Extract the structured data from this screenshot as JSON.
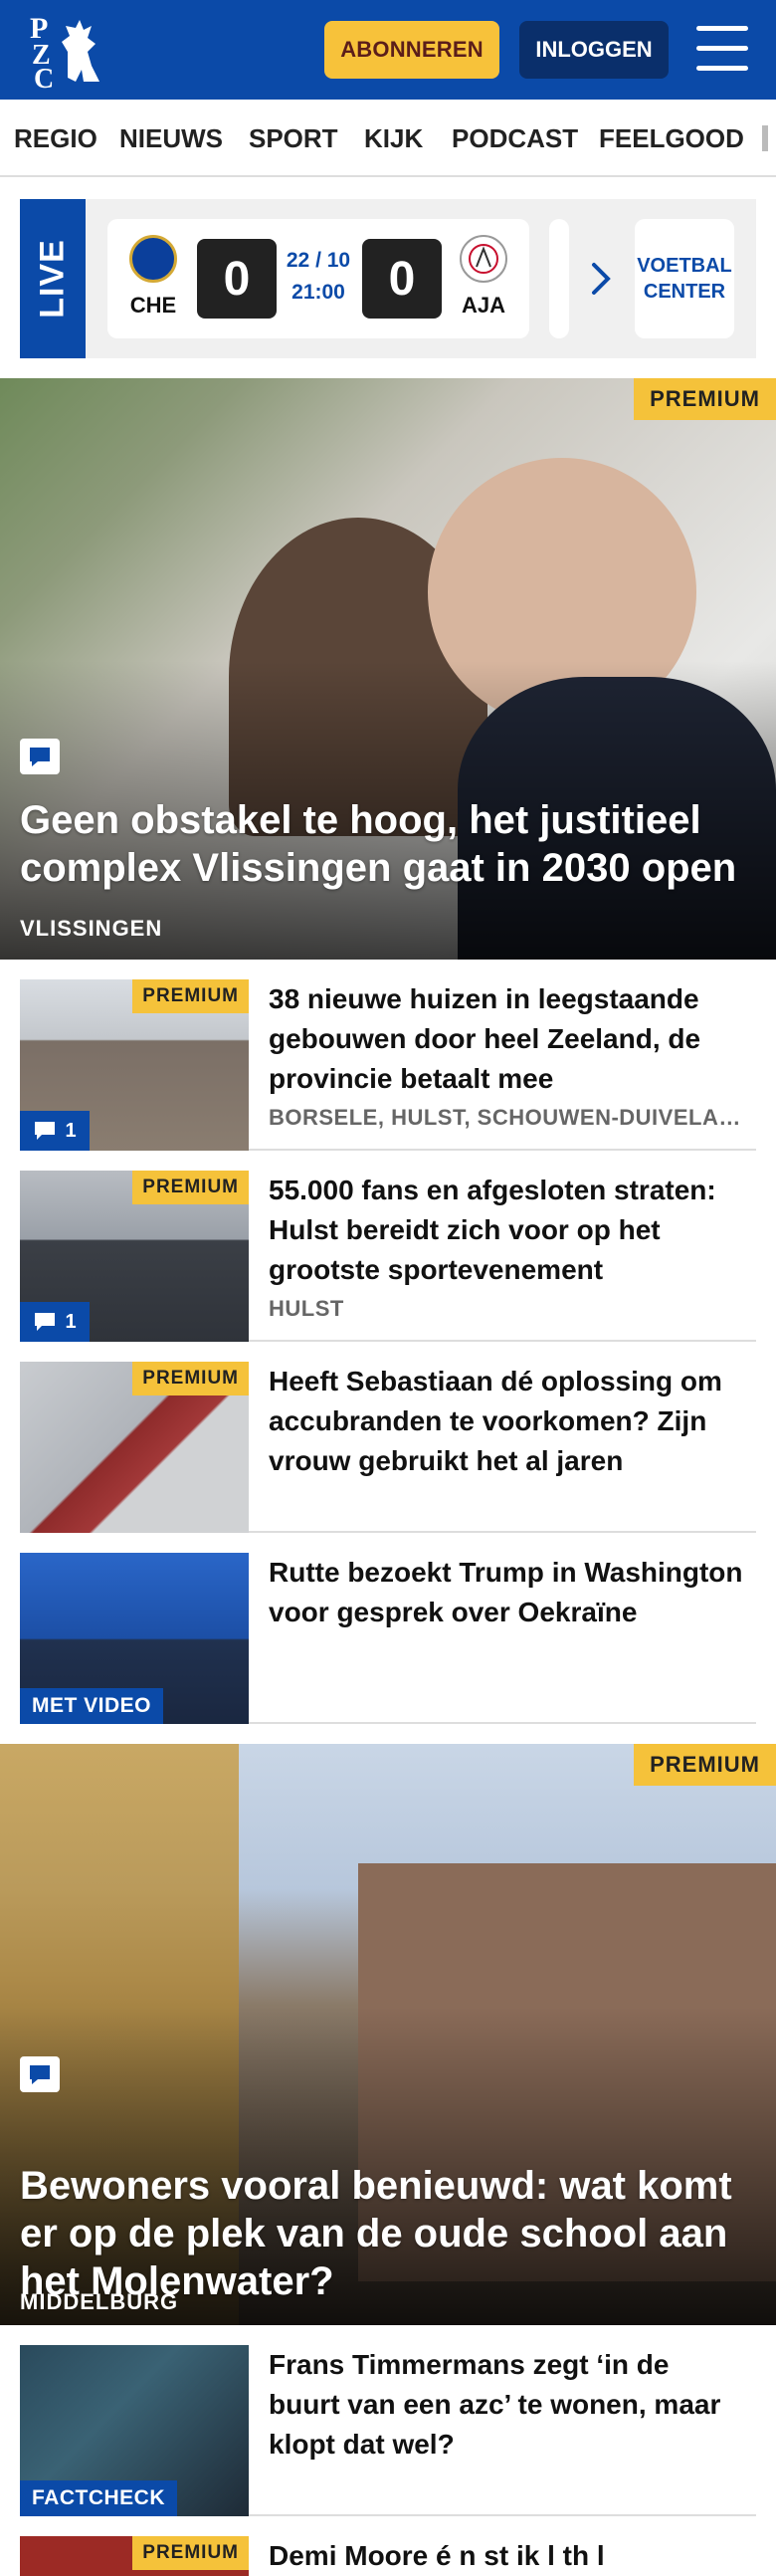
{
  "header": {
    "logo_text": "PZC",
    "subscribe_label": "ABONNEREN",
    "login_label": "INLOGGEN",
    "brand_color": "#0b4aa8",
    "accent_color": "#f7c23a"
  },
  "nav": {
    "items": [
      {
        "label": "REGIO"
      },
      {
        "label": "NIEUWS"
      },
      {
        "label": "SPORT"
      },
      {
        "label": "KIJK"
      },
      {
        "label": "PODCAST"
      },
      {
        "label": "FEELGOOD"
      }
    ]
  },
  "live": {
    "label": "LIVE",
    "home_code": "CHE",
    "away_code": "AJA",
    "home_score": "0",
    "away_score": "0",
    "date": "22 / 10",
    "time": "21:00",
    "center_label": "VOETBAL CENTER"
  },
  "hero1": {
    "badge": "PREMIUM",
    "title": "Geen obstakel te hoog, het justitieel complex Vlissingen gaat in 2030 open",
    "location": "VLISSINGEN"
  },
  "articles": [
    {
      "badge": "PREMIUM",
      "title": "38 nieuwe huizen in leegstaande gebouwen door heel Zeeland, de provincie betaalt mee",
      "location": "BORSELE, HULST, SCHOUWEN-DUIVELAND",
      "comments": "1"
    },
    {
      "badge": "PREMIUM",
      "title": "55.000 fans en afgesloten straten: Hulst bereidt zich voor op het grootste sportevenement",
      "location": "HULST",
      "comments": "1"
    },
    {
      "badge": "PREMIUM",
      "title": "Heeft Sebastiaan dé oplossing om accubranden te voorkomen? Zijn vrouw gebruikt het al jaren"
    },
    {
      "label": "MET VIDEO",
      "title": "Rutte bezoekt Trump in Washington voor gesprek over Oekraïne"
    }
  ],
  "hero2": {
    "badge": "PREMIUM",
    "title": "Bewoners vooral benieuwd: wat komt er op de plek van de oude school aan het Molenwater?",
    "location": "MIDDELBURG"
  },
  "article5": {
    "label": "FACTCHECK",
    "title": "Frans Timmermans zegt ‘in de buurt van een azc’ te wonen, maar klopt dat wel?"
  },
  "article6": {
    "badge": "PREMIUM",
    "title": "Demi Moore é n st ik l th  l"
  }
}
